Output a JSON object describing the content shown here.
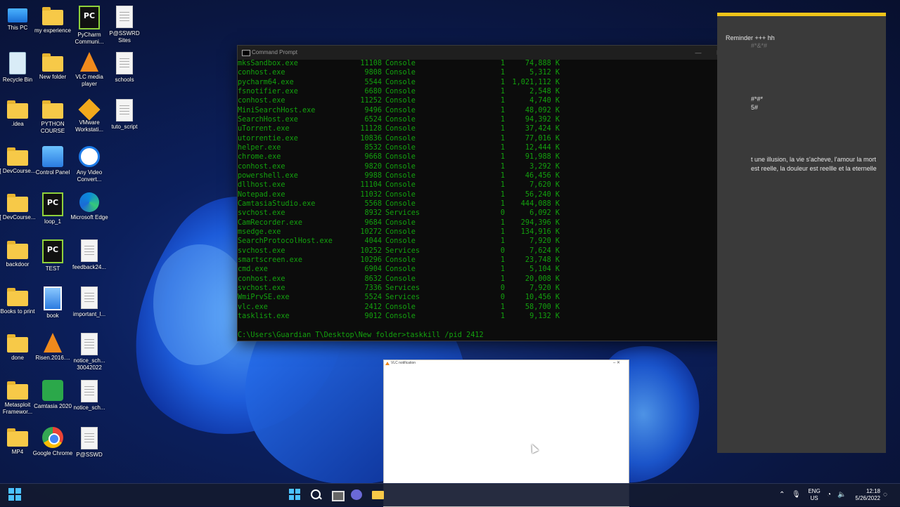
{
  "desktop": {
    "icons": [
      {
        "label": "This PC",
        "icon": "monitor-icon"
      },
      {
        "label": "my experience",
        "icon": "folder-icon"
      },
      {
        "label": "PyCharm Communi...",
        "icon": "pycharm-icon"
      },
      {
        "label": "P@SSWRD Sites",
        "icon": "file-icon"
      },
      {
        "label": "Recycle Bin",
        "icon": "recycle-bin-icon"
      },
      {
        "label": "New folder",
        "icon": "folder-icon"
      },
      {
        "label": "VLC media player",
        "icon": "vlc-icon"
      },
      {
        "label": "schools",
        "icon": "file-icon"
      },
      {
        "label": ".idea",
        "icon": "folder-icon"
      },
      {
        "label": "PYTHON COURSE",
        "icon": "folder-icon"
      },
      {
        "label": "VMware Workstati...",
        "icon": "vmware-icon"
      },
      {
        "label": "tuto_script",
        "icon": "file-icon"
      },
      {
        "label": "[ DevCourse...",
        "icon": "folder-icon"
      },
      {
        "label": "Control Panel",
        "icon": "control-panel-icon"
      },
      {
        "label": "Any Video Convert...",
        "icon": "any-video-converter-icon"
      },
      {
        "label": "[ DevCourse...",
        "icon": "folder-icon"
      },
      {
        "label": "loop_1",
        "icon": "pycharm-icon"
      },
      {
        "label": "Microsoft Edge",
        "icon": "edge-icon"
      },
      {
        "label": "backdoor",
        "icon": "folder-icon"
      },
      {
        "label": "TEST",
        "icon": "pycharm-icon"
      },
      {
        "label": "feedback24...",
        "icon": "file-icon"
      },
      {
        "label": "Books to print",
        "icon": "folder-icon"
      },
      {
        "label": "book",
        "icon": "image-file-icon"
      },
      {
        "label": "important_l...",
        "icon": "file-icon"
      },
      {
        "label": "done",
        "icon": "folder-icon"
      },
      {
        "label": "Risen.2016....",
        "icon": "vlc-icon"
      },
      {
        "label": "notice_sch... 30042022",
        "icon": "file-icon"
      },
      {
        "label": "Metasploit Framewor...",
        "icon": "folder-icon"
      },
      {
        "label": "Camtasia 2020",
        "icon": "camtasia-icon"
      },
      {
        "label": "notice_sch...",
        "icon": "file-icon"
      },
      {
        "label": "MP4",
        "icon": "folder-icon"
      },
      {
        "label": "Google Chrome",
        "icon": "chrome-icon"
      },
      {
        "label": "P@SSWD",
        "icon": "file-icon"
      }
    ]
  },
  "cmd": {
    "title": "Command Prompt",
    "minimize": "—",
    "maximize": "☐",
    "close": "✕",
    "processes": [
      [
        "mksSandbox.exe",
        "11108",
        "Console",
        "1",
        "74,888 K"
      ],
      [
        "conhost.exe",
        "9808",
        "Console",
        "1",
        "5,312 K"
      ],
      [
        "pycharm64.exe",
        "5544",
        "Console",
        "1",
        "1,021,112 K"
      ],
      [
        "fsnotifier.exe",
        "6680",
        "Console",
        "1",
        "2,548 K"
      ],
      [
        "conhost.exe",
        "11252",
        "Console",
        "1",
        "4,740 K"
      ],
      [
        "MiniSearchHost.exe",
        "9496",
        "Console",
        "1",
        "48,092 K"
      ],
      [
        "SearchHost.exe",
        "6524",
        "Console",
        "1",
        "94,392 K"
      ],
      [
        "uTorrent.exe",
        "11128",
        "Console",
        "1",
        "37,424 K"
      ],
      [
        "utorrentie.exe",
        "10836",
        "Console",
        "1",
        "77,016 K"
      ],
      [
        "helper.exe",
        "8532",
        "Console",
        "1",
        "12,444 K"
      ],
      [
        "chrome.exe",
        "9668",
        "Console",
        "1",
        "91,988 K"
      ],
      [
        "conhost.exe",
        "9820",
        "Console",
        "1",
        "3,292 K"
      ],
      [
        "powershell.exe",
        "9988",
        "Console",
        "1",
        "46,456 K"
      ],
      [
        "dllhost.exe",
        "11104",
        "Console",
        "1",
        "7,620 K"
      ],
      [
        "Notepad.exe",
        "11032",
        "Console",
        "1",
        "56,240 K"
      ],
      [
        "CamtasiaStudio.exe",
        "5568",
        "Console",
        "1",
        "444,088 K"
      ],
      [
        "svchost.exe",
        "8932",
        "Services",
        "0",
        "6,092 K"
      ],
      [
        "CamRecorder.exe",
        "9684",
        "Console",
        "1",
        "294,396 K"
      ],
      [
        "msedge.exe",
        "10272",
        "Console",
        "1",
        "134,916 K"
      ],
      [
        "SearchProtocolHost.exe",
        "4044",
        "Console",
        "1",
        "7,920 K"
      ],
      [
        "svchost.exe",
        "10252",
        "Services",
        "0",
        "7,624 K"
      ],
      [
        "smartscreen.exe",
        "10296",
        "Console",
        "1",
        "23,748 K"
      ],
      [
        "cmd.exe",
        "6904",
        "Console",
        "1",
        "5,104 K"
      ],
      [
        "conhost.exe",
        "8632",
        "Console",
        "1",
        "20,008 K"
      ],
      [
        "svchost.exe",
        "7336",
        "Services",
        "0",
        "7,920 K"
      ],
      [
        "WmiPrvSE.exe",
        "5524",
        "Services",
        "0",
        "10,456 K"
      ],
      [
        "vlc.exe",
        "2412",
        "Console",
        "1",
        "58,700 K"
      ],
      [
        "tasklist.exe",
        "9012",
        "Console",
        "1",
        "9,132 K"
      ]
    ],
    "prompt": "C:\\Users\\Guardian T\\Desktop\\New folder>taskkill /pid 2412"
  },
  "notes": {
    "line1": "Reminder +++ hh",
    "line2": "#*&*#",
    "line3": "#*#*",
    "line4": "5#",
    "line5": "t une illusion, la vie s'acheve, l'amour la mort est reelle, la douleur est reellle et la eternelle"
  },
  "vlc": {
    "title": "VLC notification",
    "controls": "–  ✕"
  },
  "taskbar": {
    "lang_top": "ENG",
    "lang_bottom": "US",
    "time": "12:18",
    "date": "5/26/2022"
  },
  "colors": {
    "console_text": "#13a10e",
    "accent": "#4cc2ff",
    "notes_accent": "#f0c419"
  }
}
